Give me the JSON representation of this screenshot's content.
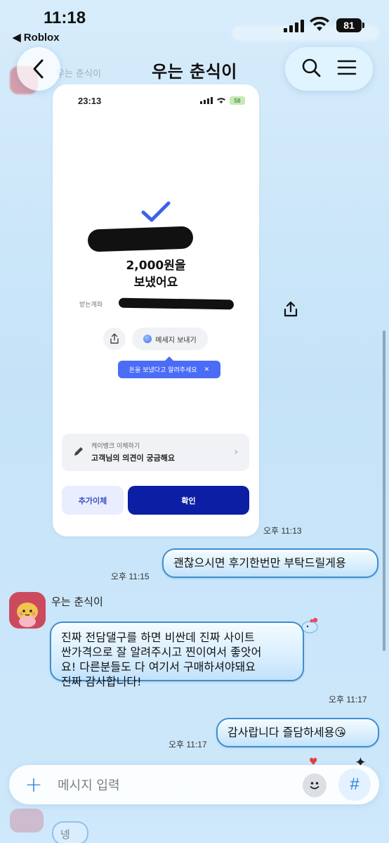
{
  "status_bar": {
    "time": "11:18",
    "back_app": "◀ Roblox",
    "battery": "81"
  },
  "header": {
    "title": "우는 춘식이",
    "faded_name": "우는 춘식이"
  },
  "shared_screenshot": {
    "time": "23:13",
    "battery": "58",
    "amount_line1": "2,000원을",
    "amount_line2": "보냈어요",
    "receiver_label": "받는계좌",
    "send_message_label": "메세지 보내기",
    "tooltip": "돈을 보냈다고 알려주세요",
    "feedback_small": "케이뱅크 이체하기",
    "feedback_big": "고객님의 의견이 궁금해요",
    "extra_transfer": "추가이체",
    "confirm": "확인"
  },
  "messages": [
    {
      "timestamp": "오후 11:13"
    },
    {
      "text": "괜찮으시면 후기한번만 부탁드릴게용",
      "timestamp": "오후 11:15"
    },
    {
      "sender": "우는 춘식이",
      "text_line1": "진짜 전담댈구를 하면 비싼데 진짜 사이트",
      "text_line2": "싼가격으로 잘 알려주시고 찐이여서 좋앗어",
      "text_line3": "요! 다른분들도 다 여기서 구매하셔야돼요",
      "text_line4": "진짜 감사합니다!",
      "timestamp": "오후 11:17"
    },
    {
      "text": "감사랍니다 즐담하세용😘",
      "timestamp": "오후 11:17"
    }
  ],
  "input": {
    "placeholder": "메시지 입력",
    "hash": "#",
    "plus": "+"
  },
  "below_fold": {
    "bubble": "넹"
  },
  "colors": {
    "accent": "#2d86d8",
    "bubble_border": "#3d8fcf",
    "confirm_button": "#0c1ea3",
    "tooltip": "#4a6cf7"
  }
}
